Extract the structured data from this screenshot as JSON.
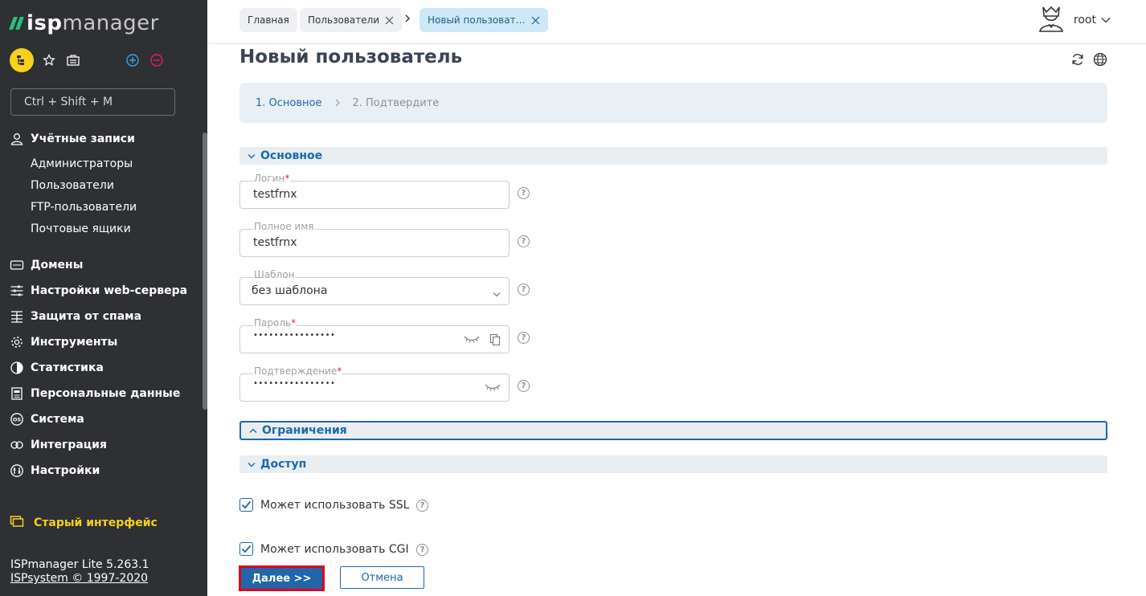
{
  "app": {
    "logo_brand": "isp",
    "logo_rest": "manager"
  },
  "sidebar": {
    "search_placeholder": "Ctrl + Shift + M",
    "menu": [
      {
        "label": "Учётные записи",
        "icon": "users-icon"
      },
      {
        "label": "Домены",
        "icon": "domains-icon"
      },
      {
        "label": "Настройки web-сервера",
        "icon": "sliders-icon"
      },
      {
        "label": "Защита от спама",
        "icon": "spam-shield-icon"
      },
      {
        "label": "Инструменты",
        "icon": "gear-icon"
      },
      {
        "label": "Статистика",
        "icon": "pie-chart-icon"
      },
      {
        "label": "Персональные данные",
        "icon": "personal-data-icon"
      },
      {
        "label": "Система",
        "icon": "os-icon"
      },
      {
        "label": "Интеграция",
        "icon": "integration-icon"
      },
      {
        "label": "Настройки",
        "icon": "settings-icon"
      }
    ],
    "submenu": [
      "Администраторы",
      "Пользователи",
      "FTP-пользователи",
      "Почтовые ящики"
    ],
    "old_interface": "Старый интерфейс",
    "version": "ISPmanager Lite 5.263.1",
    "copyright": "ISPsystem © 1997-2020"
  },
  "topbar": {
    "breadcrumbs": [
      "Главная",
      "Пользователи",
      "Новый пользоват…"
    ],
    "user": "root"
  },
  "main": {
    "title": "Новый пользователь",
    "wizard": {
      "step1": "1. Основное",
      "step2": "2. Подтвердите"
    },
    "sections": {
      "basic": "Основное",
      "limits": "Ограничения",
      "access": "Доступ"
    },
    "fields": {
      "login": {
        "label": "Логин",
        "value": "testfrnx",
        "required": "*"
      },
      "fullname": {
        "label": "Полное имя",
        "value": "testfrnx"
      },
      "template": {
        "label": "Шаблон",
        "value": "без шаблона"
      },
      "password": {
        "label": "Пароль",
        "value": "••••••••••••••••",
        "required": "*"
      },
      "confirm": {
        "label": "Подтверждение",
        "value": "••••••••••••••••",
        "required": "*"
      }
    },
    "checkboxes": {
      "ssl": {
        "label": "Может использовать SSL",
        "checked": true
      },
      "cgi": {
        "label": "Может использовать CGI",
        "checked": true
      }
    },
    "buttons": {
      "next": "Далее >>",
      "cancel": "Отмена"
    },
    "help_glyph": "?"
  },
  "colors": {
    "sidebar_bg": "#2e3033",
    "accent_blue": "#2266aa",
    "logo_green": "#27c27b",
    "accent_yellow": "#f7d11a",
    "required_pink": "#e21b6b"
  }
}
